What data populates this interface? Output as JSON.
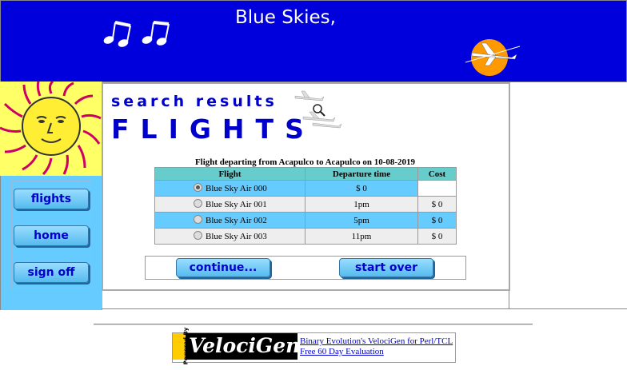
{
  "header": {
    "title": "Blue Skies,"
  },
  "nav": {
    "flights": "flights",
    "home": "home",
    "sign_off": "sign off"
  },
  "main": {
    "subtitle": "search results",
    "title": "FLIGHTS",
    "caption": "Flight departing from Acapulco to Acapulco on 10-08-2019",
    "columns": [
      "Flight",
      "Departure time",
      "Cost"
    ],
    "rows": [
      {
        "flight": "Blue Sky Air 000",
        "time": "$ 0",
        "cost": "",
        "selected": true
      },
      {
        "flight": "Blue Sky Air 001",
        "time": "1pm",
        "cost": "$ 0",
        "selected": false
      },
      {
        "flight": "Blue Sky Air 002",
        "time": "5pm",
        "cost": "$ 0",
        "selected": false
      },
      {
        "flight": "Blue Sky Air 003",
        "time": "11pm",
        "cost": "$ 0",
        "selected": false
      }
    ],
    "continue_label": "continue...",
    "start_over_label": "start over"
  },
  "footer": {
    "powered_by": "Powered By",
    "logo_text": "VelociGen!",
    "link1": "Binary Evolution's VelociGen for Perl/TCL",
    "link2": "Free 60 Day Evaluation"
  },
  "colors": {
    "header_bg": "#0000dd",
    "sidebar_bg": "#66ccff",
    "accent_text": "#0000cc"
  }
}
